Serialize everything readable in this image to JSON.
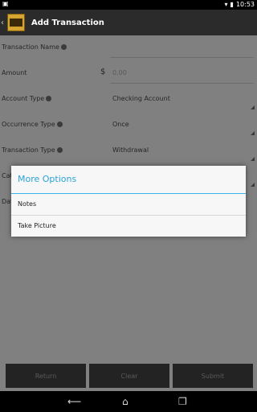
{
  "status_bar": {
    "time": "10:53",
    "notification_icon": "photo-icon"
  },
  "action_bar": {
    "title": "Add Transaction"
  },
  "form": {
    "transaction_name_label": "Transaction Name",
    "transaction_name_value": "",
    "amount_label": "Amount",
    "amount_currency": "$",
    "amount_placeholder": "0.00",
    "account_type_label": "Account Type",
    "account_type_value": "Checking Account",
    "occurrence_type_label": "Occurrence Type",
    "occurrence_type_value": "Once",
    "transaction_type_label": "Transaction Type",
    "transaction_type_value": "Withdrawal",
    "category_label_partial": "Cat",
    "date_label_partial": "Dat"
  },
  "dialog": {
    "title": "More Options",
    "items": [
      "Notes",
      "Take Picture"
    ]
  },
  "buttons": {
    "return": "Return",
    "clear": "Clear",
    "submit": "Submit"
  }
}
